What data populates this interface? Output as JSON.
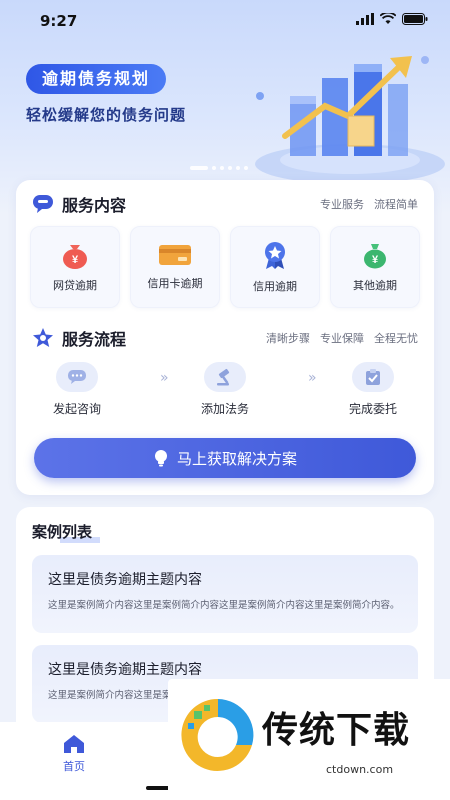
{
  "status_bar": {
    "time": "9:27"
  },
  "banner": {
    "title": "逾期债务规划",
    "subtitle": "轻松缓解您的债务问题",
    "dots": 6,
    "active_dot": 0
  },
  "services": {
    "title": "服务内容",
    "tags": [
      "专业服务",
      "流程简单"
    ],
    "items": [
      {
        "label": "网贷逾期",
        "icon": "money-bag-icon"
      },
      {
        "label": "信用卡逾期",
        "icon": "credit-card-icon"
      },
      {
        "label": "信用逾期",
        "icon": "award-badge-icon"
      },
      {
        "label": "其他逾期",
        "icon": "cash-bag-icon"
      }
    ]
  },
  "process": {
    "title": "服务流程",
    "tags": [
      "清晰步骤",
      "专业保障",
      "全程无忧"
    ],
    "steps": [
      {
        "label": "发起咨询",
        "icon": "chat-bubble-icon"
      },
      {
        "label": "添加法务",
        "icon": "gavel-icon"
      },
      {
        "label": "完成委托",
        "icon": "clipboard-check-icon"
      }
    ],
    "cta_label": "马上获取解决方案"
  },
  "cases": {
    "title": "案例列表",
    "items": [
      {
        "title": "这里是债务逾期主题内容",
        "desc": "这里是案例简介内容这里是案例简介内容这里是案例简介内容这里是案例简介内容。"
      },
      {
        "title": "这里是债务逾期主题内容",
        "desc": "这里是案例简介内容这里是案例简介内容这里是案例简介内容这里是案例简介内容。"
      }
    ]
  },
  "bottom_nav": {
    "home_label": "首页"
  },
  "watermark": {
    "text": "传统下载",
    "url": "ctdown.com"
  },
  "colors": {
    "primary": "#3f59d9",
    "accent": "#2f57e6",
    "background": "#eef2fb"
  }
}
